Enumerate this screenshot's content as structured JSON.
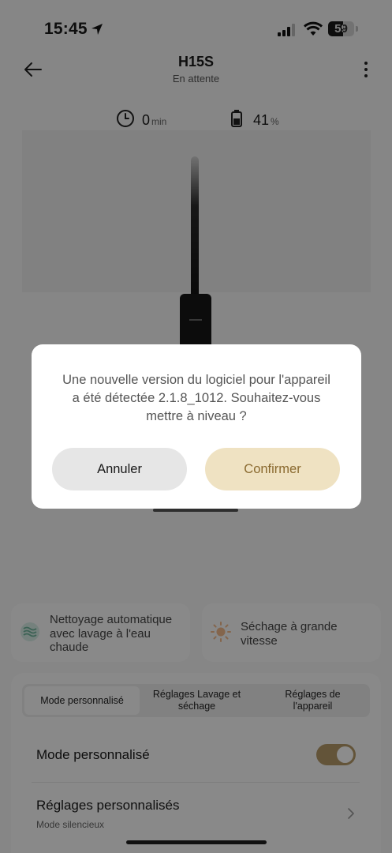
{
  "status_bar": {
    "time": "15:45",
    "battery_level": "59"
  },
  "header": {
    "title": "H15S",
    "subtitle": "En attente"
  },
  "stats": {
    "time_value": "0",
    "time_unit": "min",
    "battery_value": "41",
    "battery_unit": "%"
  },
  "features": [
    {
      "label": "Nettoyage automatique avec lavage à l'eau chaude",
      "lines": [
        "Nettoyage automatique",
        "avec lavage à l'eau",
        "chaude"
      ],
      "icon": "waves-icon"
    },
    {
      "label": "Séchage à grande vitesse",
      "lines": [
        "Séchage à grande",
        "vitesse"
      ],
      "icon": "sun-icon"
    }
  ],
  "tabs": [
    {
      "label": "Mode personnalisé",
      "active": true
    },
    {
      "label": "Réglages Lavage et séchage",
      "lines": [
        "Réglages Lavage et",
        "séchage"
      ],
      "active": false
    },
    {
      "label": "Réglages de l'appareil",
      "lines": [
        "Réglages de",
        "l'appareil"
      ],
      "active": false
    }
  ],
  "settings": {
    "custom_mode_label": "Mode personnalisé",
    "custom_mode_enabled": true,
    "custom_settings_label": "Réglages personnalisés",
    "custom_settings_value": "Mode silencieux"
  },
  "dialog": {
    "message_lines": [
      "Une nouvelle version du logiciel pour l'appareil",
      "a été détectée 2.1.8_1012. Souhaitez-vous",
      "mettre à niveau ?"
    ],
    "cancel_label": "Annuler",
    "confirm_label": "Confirmer"
  },
  "colors": {
    "accent": "#b59a69",
    "confirm_bg": "#efe2c2",
    "confirm_text": "#8a6a30",
    "overlay": "rgba(0,0,0,0.45)"
  }
}
